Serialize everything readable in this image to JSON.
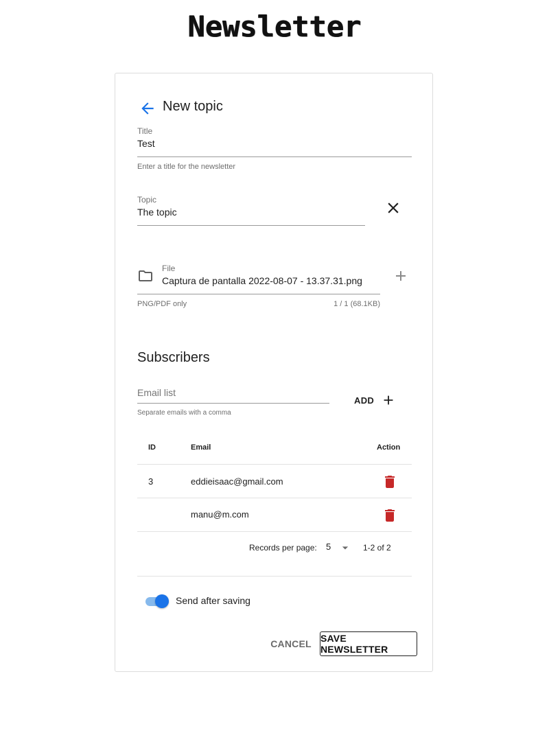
{
  "app": {
    "title": "Newsletter"
  },
  "form": {
    "heading": "New topic",
    "title_field": {
      "label": "Title",
      "value": "Test",
      "hint": "Enter a title for the newsletter"
    },
    "topic_field": {
      "label": "Topic",
      "value": "The topic"
    },
    "file_field": {
      "label": "File",
      "value": "Captura de pantalla 2022-08-07 - 13.37.31.png",
      "hint": "PNG/PDF only",
      "counter": "1 / 1 (68.1KB)"
    }
  },
  "subscribers": {
    "title": "Subscribers",
    "email_input": {
      "placeholder": "Email list",
      "hint": "Separate emails with a comma"
    },
    "add_label": "ADD",
    "table": {
      "headers": {
        "id": "ID",
        "email": "Email",
        "action": "Action"
      },
      "rows": [
        {
          "id": "3",
          "email": "eddieisaac@gmail.com"
        },
        {
          "id": "",
          "email": "manu@m.com"
        }
      ]
    },
    "pagination": {
      "records_label": "Records per page:",
      "per_page": "5",
      "range": "1-2 of 2"
    }
  },
  "send_toggle": {
    "label": "Send after saving",
    "checked": true
  },
  "actions": {
    "cancel": "CANCEL",
    "save": "SAVE NEWSLETTER"
  },
  "colors": {
    "accent": "#1a73e8",
    "delete": "#c62828",
    "toggle_track": "#86b9ec"
  },
  "icons": {
    "back": "arrow-left-icon",
    "clear": "close-icon",
    "file": "folder-icon",
    "add_file": "plus-icon",
    "add_email": "plus-icon",
    "delete": "trash-icon",
    "dropdown": "caret-down-icon"
  }
}
